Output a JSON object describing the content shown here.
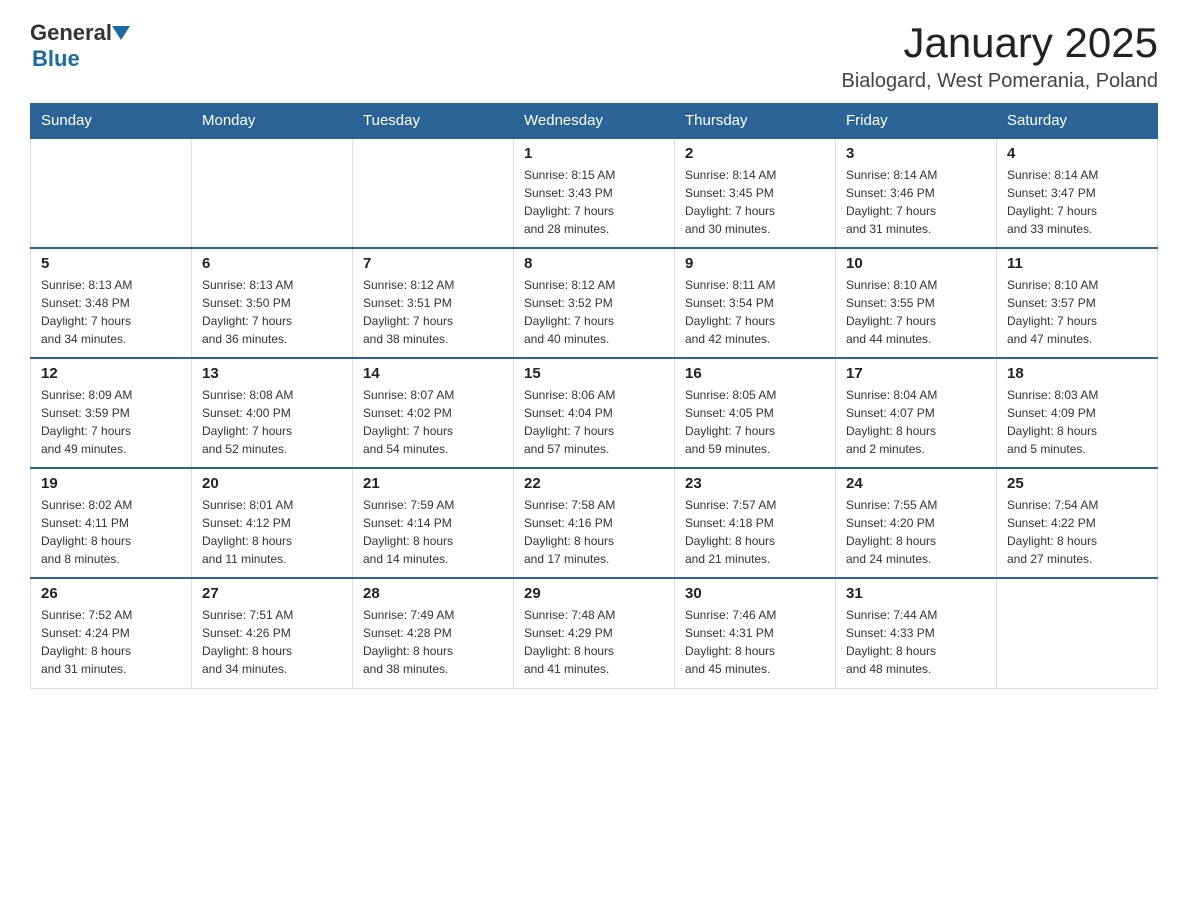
{
  "header": {
    "logo_general": "General",
    "logo_blue": "Blue",
    "month_title": "January 2025",
    "location": "Bialogard, West Pomerania, Poland"
  },
  "days_of_week": [
    "Sunday",
    "Monday",
    "Tuesday",
    "Wednesday",
    "Thursday",
    "Friday",
    "Saturday"
  ],
  "weeks": [
    [
      {
        "day": "",
        "info": ""
      },
      {
        "day": "",
        "info": ""
      },
      {
        "day": "",
        "info": ""
      },
      {
        "day": "1",
        "info": "Sunrise: 8:15 AM\nSunset: 3:43 PM\nDaylight: 7 hours\nand 28 minutes."
      },
      {
        "day": "2",
        "info": "Sunrise: 8:14 AM\nSunset: 3:45 PM\nDaylight: 7 hours\nand 30 minutes."
      },
      {
        "day": "3",
        "info": "Sunrise: 8:14 AM\nSunset: 3:46 PM\nDaylight: 7 hours\nand 31 minutes."
      },
      {
        "day": "4",
        "info": "Sunrise: 8:14 AM\nSunset: 3:47 PM\nDaylight: 7 hours\nand 33 minutes."
      }
    ],
    [
      {
        "day": "5",
        "info": "Sunrise: 8:13 AM\nSunset: 3:48 PM\nDaylight: 7 hours\nand 34 minutes."
      },
      {
        "day": "6",
        "info": "Sunrise: 8:13 AM\nSunset: 3:50 PM\nDaylight: 7 hours\nand 36 minutes."
      },
      {
        "day": "7",
        "info": "Sunrise: 8:12 AM\nSunset: 3:51 PM\nDaylight: 7 hours\nand 38 minutes."
      },
      {
        "day": "8",
        "info": "Sunrise: 8:12 AM\nSunset: 3:52 PM\nDaylight: 7 hours\nand 40 minutes."
      },
      {
        "day": "9",
        "info": "Sunrise: 8:11 AM\nSunset: 3:54 PM\nDaylight: 7 hours\nand 42 minutes."
      },
      {
        "day": "10",
        "info": "Sunrise: 8:10 AM\nSunset: 3:55 PM\nDaylight: 7 hours\nand 44 minutes."
      },
      {
        "day": "11",
        "info": "Sunrise: 8:10 AM\nSunset: 3:57 PM\nDaylight: 7 hours\nand 47 minutes."
      }
    ],
    [
      {
        "day": "12",
        "info": "Sunrise: 8:09 AM\nSunset: 3:59 PM\nDaylight: 7 hours\nand 49 minutes."
      },
      {
        "day": "13",
        "info": "Sunrise: 8:08 AM\nSunset: 4:00 PM\nDaylight: 7 hours\nand 52 minutes."
      },
      {
        "day": "14",
        "info": "Sunrise: 8:07 AM\nSunset: 4:02 PM\nDaylight: 7 hours\nand 54 minutes."
      },
      {
        "day": "15",
        "info": "Sunrise: 8:06 AM\nSunset: 4:04 PM\nDaylight: 7 hours\nand 57 minutes."
      },
      {
        "day": "16",
        "info": "Sunrise: 8:05 AM\nSunset: 4:05 PM\nDaylight: 7 hours\nand 59 minutes."
      },
      {
        "day": "17",
        "info": "Sunrise: 8:04 AM\nSunset: 4:07 PM\nDaylight: 8 hours\nand 2 minutes."
      },
      {
        "day": "18",
        "info": "Sunrise: 8:03 AM\nSunset: 4:09 PM\nDaylight: 8 hours\nand 5 minutes."
      }
    ],
    [
      {
        "day": "19",
        "info": "Sunrise: 8:02 AM\nSunset: 4:11 PM\nDaylight: 8 hours\nand 8 minutes."
      },
      {
        "day": "20",
        "info": "Sunrise: 8:01 AM\nSunset: 4:12 PM\nDaylight: 8 hours\nand 11 minutes."
      },
      {
        "day": "21",
        "info": "Sunrise: 7:59 AM\nSunset: 4:14 PM\nDaylight: 8 hours\nand 14 minutes."
      },
      {
        "day": "22",
        "info": "Sunrise: 7:58 AM\nSunset: 4:16 PM\nDaylight: 8 hours\nand 17 minutes."
      },
      {
        "day": "23",
        "info": "Sunrise: 7:57 AM\nSunset: 4:18 PM\nDaylight: 8 hours\nand 21 minutes."
      },
      {
        "day": "24",
        "info": "Sunrise: 7:55 AM\nSunset: 4:20 PM\nDaylight: 8 hours\nand 24 minutes."
      },
      {
        "day": "25",
        "info": "Sunrise: 7:54 AM\nSunset: 4:22 PM\nDaylight: 8 hours\nand 27 minutes."
      }
    ],
    [
      {
        "day": "26",
        "info": "Sunrise: 7:52 AM\nSunset: 4:24 PM\nDaylight: 8 hours\nand 31 minutes."
      },
      {
        "day": "27",
        "info": "Sunrise: 7:51 AM\nSunset: 4:26 PM\nDaylight: 8 hours\nand 34 minutes."
      },
      {
        "day": "28",
        "info": "Sunrise: 7:49 AM\nSunset: 4:28 PM\nDaylight: 8 hours\nand 38 minutes."
      },
      {
        "day": "29",
        "info": "Sunrise: 7:48 AM\nSunset: 4:29 PM\nDaylight: 8 hours\nand 41 minutes."
      },
      {
        "day": "30",
        "info": "Sunrise: 7:46 AM\nSunset: 4:31 PM\nDaylight: 8 hours\nand 45 minutes."
      },
      {
        "day": "31",
        "info": "Sunrise: 7:44 AM\nSunset: 4:33 PM\nDaylight: 8 hours\nand 48 minutes."
      },
      {
        "day": "",
        "info": ""
      }
    ]
  ]
}
